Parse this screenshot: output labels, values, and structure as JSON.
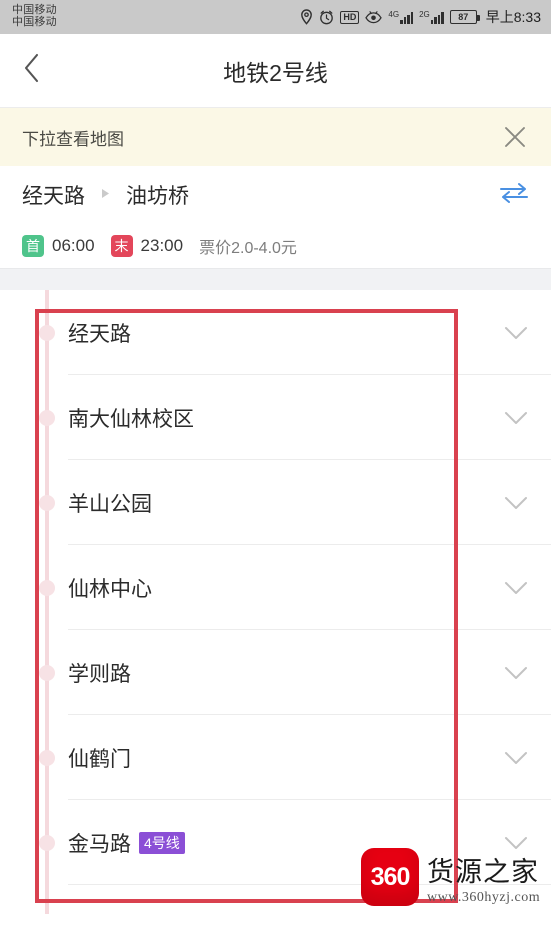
{
  "status_bar": {
    "carrier_line1": "中国移动",
    "carrier_line2": "中国移动",
    "icons": [
      "location-pin-icon",
      "alarm-clock-icon",
      "hd-icon",
      "eye-icon",
      "signal-4g-icon",
      "signal-2g-icon",
      "battery-icon"
    ],
    "hd_label": "HD",
    "net_4g_label": "4G",
    "net_2g_label": "2G",
    "battery_level": "87",
    "time": "早上8:33"
  },
  "navbar": {
    "back_icon": "chevron-left-icon",
    "title": "地铁2号线"
  },
  "tip_banner": {
    "text": "下拉查看地图",
    "close_icon": "close-icon",
    "background_color": "#fbf8e6"
  },
  "route": {
    "from": "经天路",
    "arrow": "▶",
    "to": "油坊桥",
    "swap_icon": "swap-arrows-icon",
    "swap_color": "#4a90e2"
  },
  "fare": {
    "first_badge": "首",
    "first_time": "06:00",
    "last_badge": "末",
    "last_time": "23:00",
    "price_text": "票价2.0-4.0元",
    "first_badge_color": "#4fc48b",
    "last_badge_color": "#e3465a"
  },
  "stations": [
    {
      "name": "经天路",
      "line_badge": null,
      "expand_icon": "chevron-down-icon"
    },
    {
      "name": "南大仙林校区",
      "line_badge": null,
      "expand_icon": "chevron-down-icon"
    },
    {
      "name": "羊山公园",
      "line_badge": null,
      "expand_icon": "chevron-down-icon"
    },
    {
      "name": "仙林中心",
      "line_badge": null,
      "expand_icon": "chevron-down-icon"
    },
    {
      "name": "学则路",
      "line_badge": null,
      "expand_icon": "chevron-down-icon"
    },
    {
      "name": "仙鹤门",
      "line_badge": null,
      "expand_icon": "chevron-down-icon"
    },
    {
      "name": "金马路",
      "line_badge": "4号线",
      "expand_icon": "chevron-down-icon"
    }
  ],
  "annotation": {
    "shape": "rectangle",
    "color": "#d9414f"
  },
  "watermark": {
    "logo_text": "360",
    "brand": "货源之家",
    "url": "www.360hyzj.com",
    "logo_color": "#e60012"
  }
}
